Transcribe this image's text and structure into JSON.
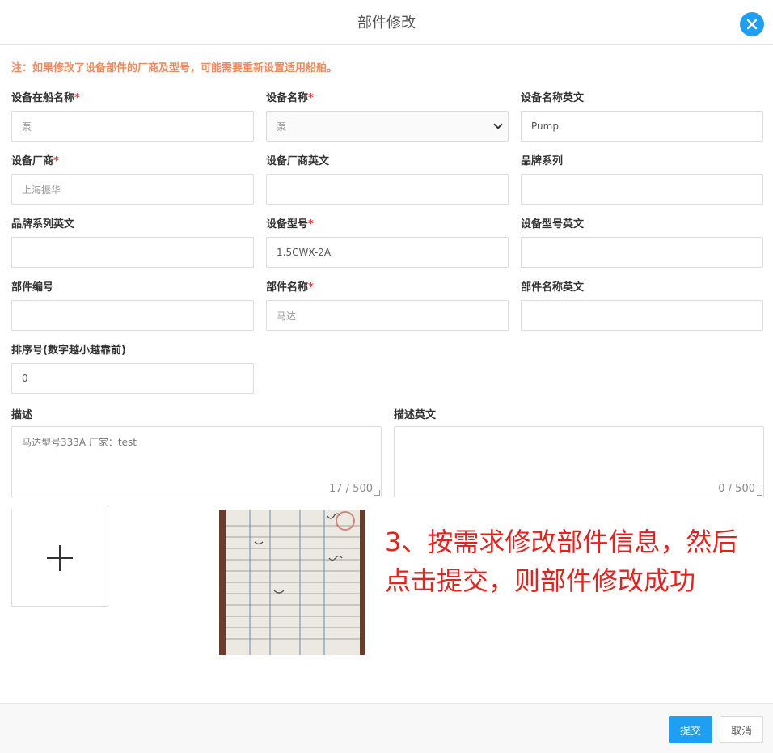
{
  "dialog": {
    "title": "部件修改"
  },
  "note": "注：如果修改了设备部件的厂商及型号，可能需要重新设置适用船舶。",
  "fields": {
    "onboard_name": {
      "label": "设备在船名称",
      "required": "*",
      "value": "泵"
    },
    "device_name": {
      "label": "设备名称",
      "required": "*",
      "value": "泵"
    },
    "device_name_en": {
      "label": "设备名称英文",
      "value": "Pump"
    },
    "manufacturer": {
      "label": "设备厂商",
      "required": "*",
      "value": "上海振华"
    },
    "manufacturer_en": {
      "label": "设备厂商英文",
      "value": ""
    },
    "brand_series": {
      "label": "品牌系列",
      "value": ""
    },
    "brand_series_en": {
      "label": "品牌系列英文",
      "value": ""
    },
    "model": {
      "label": "设备型号",
      "required": "*",
      "value": "1.5CWX-2A"
    },
    "model_en": {
      "label": "设备型号英文",
      "value": ""
    },
    "part_no": {
      "label": "部件编号",
      "value": ""
    },
    "part_name": {
      "label": "部件名称",
      "required": "*",
      "value": "马达"
    },
    "part_name_en": {
      "label": "部件名称英文",
      "value": ""
    },
    "sort_no": {
      "label": "排序号(数字越小越靠前)",
      "value": "0"
    }
  },
  "description": {
    "label": "描述",
    "value": "马达型号333A  厂家：test",
    "count": "17 / 500"
  },
  "description_en": {
    "label": "描述英文",
    "value": "",
    "count": "0 / 500"
  },
  "annotation": {
    "line1": "3、按需求修改部件信息，然后",
    "line2": "点击提交，则部件修改成功"
  },
  "footer": {
    "submit_label": "提交",
    "cancel_label": "取消"
  },
  "colors": {
    "accent": "#1e9ff2",
    "required": "#e63c3c",
    "note": "#f08a5d",
    "annotation": "#e8211d"
  },
  "icons": {
    "close": "close-icon",
    "add": "plus-icon",
    "dropdown": "chevron-down-icon"
  }
}
